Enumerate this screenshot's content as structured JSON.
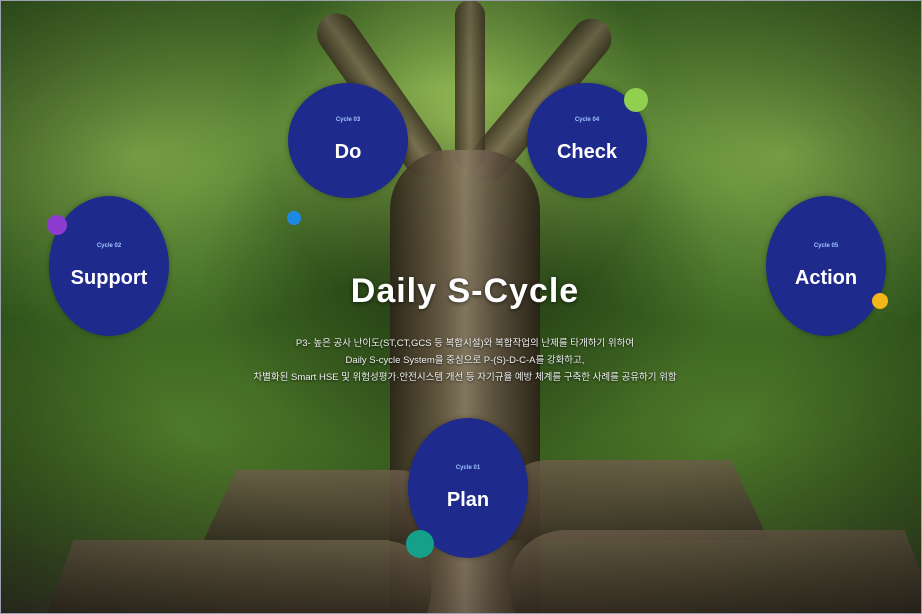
{
  "title": "Daily S-Cycle",
  "description": [
    "P3- 높은 공사 난이도(ST,CT,GCS 등 복합시설)와 복합작업의 난제를 타개하기 위하여",
    "Daily S-cycle System을 중심으로 P-(S)-D-C-A를 강화하고,",
    "차별화된 Smart HSE 및 위험성평가·안전시스템 개선 등 자기규율 예방 체계를 구축한 사례를 공유하기 위함"
  ],
  "cycles": {
    "plan": {
      "num": "Cycle 01",
      "name": "Plan"
    },
    "support": {
      "num": "Cycle 02",
      "name": "Support"
    },
    "do": {
      "num": "Cycle 03",
      "name": "Do"
    },
    "check": {
      "num": "Cycle 04",
      "name": "Check"
    },
    "action": {
      "num": "Cycle 05",
      "name": "Action"
    }
  },
  "colors": {
    "circle": "#1e2a8c",
    "dot_green": "#8fd14f",
    "dot_purple": "#8e3bd0",
    "dot_blue": "#1e88e5",
    "dot_yellow": "#f2b619",
    "dot_teal": "#15a08a"
  }
}
